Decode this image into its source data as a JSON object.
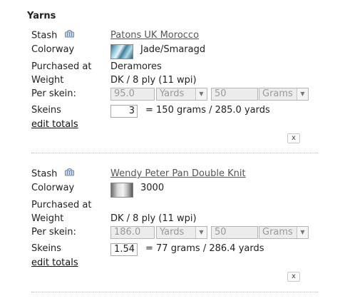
{
  "section_title": "Yarns",
  "labels": {
    "stash": "Stash",
    "colorway": "Colorway",
    "purchased_at": "Purchased at",
    "weight": "Weight",
    "per_skein": "Per skein:",
    "skeins": "Skeins",
    "edit_totals": "edit totals",
    "remove": "x"
  },
  "yarns": [
    {
      "name": "Patons UK Morocco",
      "colorway": "Jade/Smaragd",
      "purchased_at": "Deramores",
      "weight": "DK / 8 ply (11 wpi)",
      "per_skein_length": "95.0",
      "length_unit": "Yards",
      "per_skein_weight": "50",
      "weight_unit": "Grams",
      "skeins": "3",
      "totals": "= 150 grams / 285.0 yards"
    },
    {
      "name": "Wendy Peter Pan Double Knit",
      "colorway": "3000",
      "purchased_at": "",
      "weight": "DK / 8 ply (11 wpi)",
      "per_skein_length": "186.0",
      "length_unit": "Yards",
      "per_skein_weight": "50",
      "weight_unit": "Grams",
      "skeins": "1.54",
      "totals": "= 77 grams / 286.4 yards"
    }
  ]
}
